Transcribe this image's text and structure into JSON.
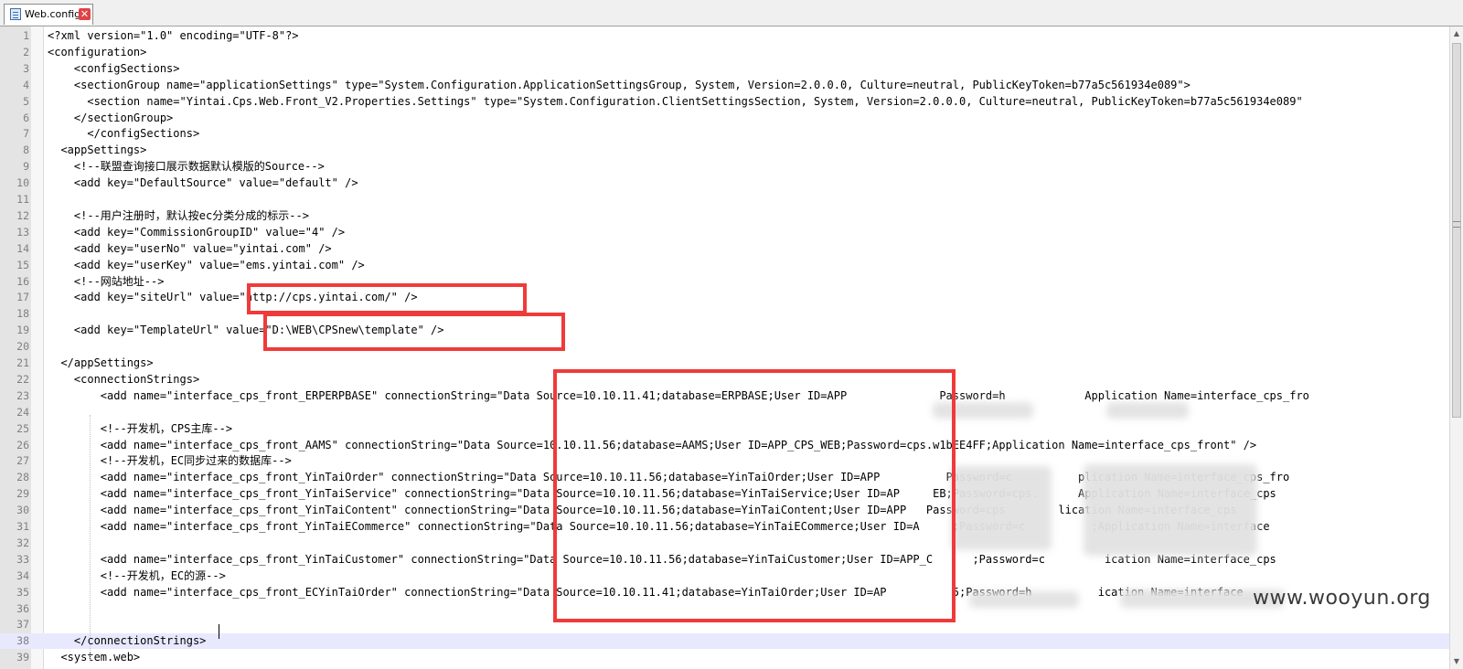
{
  "tab": {
    "label": "Web.config",
    "file_icon": "file-icon",
    "close_icon": "close-icon"
  },
  "editor": {
    "lines": [
      {
        "n": "1",
        "text": "<?xml version=\"1.0\" encoding=\"UTF-8\"?>"
      },
      {
        "n": "2",
        "text": "<configuration>"
      },
      {
        "n": "3",
        "text": "    <configSections>"
      },
      {
        "n": "4",
        "text": "    <sectionGroup name=\"applicationSettings\" type=\"System.Configuration.ApplicationSettingsGroup, System, Version=2.0.0.0, Culture=neutral, PublicKeyToken=b77a5c561934e089\">"
      },
      {
        "n": "5",
        "text": "      <section name=\"Yintai.Cps.Web.Front_V2.Properties.Settings\" type=\"System.Configuration.ClientSettingsSection, System, Version=2.0.0.0, Culture=neutral, PublicKeyToken=b77a5c561934e089\""
      },
      {
        "n": "6",
        "text": "    </sectionGroup>"
      },
      {
        "n": "7",
        "text": "      </configSections>"
      },
      {
        "n": "8",
        "text": "  <appSettings>"
      },
      {
        "n": "9",
        "text": "    <!--联盟查询接口展示数据默认模版的Source-->"
      },
      {
        "n": "10",
        "text": "    <add key=\"DefaultSource\" value=\"default\" />"
      },
      {
        "n": "11",
        "text": ""
      },
      {
        "n": "12",
        "text": "    <!--用户注册时，默认按ec分类分成的标示-->"
      },
      {
        "n": "13",
        "text": "    <add key=\"CommissionGroupID\" value=\"4\" />"
      },
      {
        "n": "14",
        "text": "    <add key=\"userNo\" value=\"yintai.com\" />"
      },
      {
        "n": "15",
        "text": "    <add key=\"userKey\" value=\"ems.yintai.com\" />"
      },
      {
        "n": "16",
        "text": "    <!--网站地址-->"
      },
      {
        "n": "17",
        "text": "    <add key=\"siteUrl\" value=\"http://cps.yintai.com/\" />"
      },
      {
        "n": "18",
        "text": ""
      },
      {
        "n": "19",
        "text": "    <add key=\"TemplateUrl\" value=\"D:\\WEB\\CPSnew\\template\" />"
      },
      {
        "n": "20",
        "text": ""
      },
      {
        "n": "21",
        "text": "  </appSettings>"
      },
      {
        "n": "22",
        "text": "    <connectionStrings>"
      },
      {
        "n": "23",
        "text": "        <add name=\"interface_cps_front_ERPERPBASE\" connectionString=\"Data Source=10.10.11.41;database=ERPBASE;User ID=APP              Password=h            Application Name=interface_cps_fro"
      },
      {
        "n": "24",
        "text": ""
      },
      {
        "n": "25",
        "text": "        <!--开发机，CPS主库-->"
      },
      {
        "n": "26",
        "text": "        <add name=\"interface_cps_front_AAMS\" connectionString=\"Data Source=10.10.11.56;database=AAMS;User ID=APP_CPS_WEB;Password=cps.w1bEE4FF;Application Name=interface_cps_front\" />"
      },
      {
        "n": "27",
        "text": "        <!--开发机，EC同步过来的数据库-->"
      },
      {
        "n": "28",
        "text": "        <add name=\"interface_cps_front_YinTaiOrder\" connectionString=\"Data Source=10.10.11.56;database=YinTaiOrder;User ID=APP          Password=c          plication Name=interface_cps_fro"
      },
      {
        "n": "29",
        "text": "        <add name=\"interface_cps_front_YinTaiService\" connectionString=\"Data Source=10.10.11.56;database=YinTaiService;User ID=AP     EB;Password=cps.      Application Name=interface_cps"
      },
      {
        "n": "30",
        "text": "        <add name=\"interface_cps_front_YinTaiContent\" connectionString=\"Data Source=10.10.11.56;database=YinTaiContent;User ID=APP   Password=cps        lication Name=interface_cps"
      },
      {
        "n": "31",
        "text": "        <add name=\"interface_cps_front_YinTaiECommerce\" connectionString=\"Data Source=10.10.11.56;database=YinTaiECommerce;User ID=A     ;Password=c          ;Application Name=interface"
      },
      {
        "n": "32",
        "text": ""
      },
      {
        "n": "33",
        "text": "        <add name=\"interface_cps_front_YinTaiCustomer\" connectionString=\"Data Source=10.10.11.56;database=YinTaiCustomer;User ID=APP_C      ;Password=c         ication Name=interface_cps"
      },
      {
        "n": "34",
        "text": "        <!--开发机，EC的源-->"
      },
      {
        "n": "35",
        "text": "        <add name=\"interface_cps_front_ECYinTaiOrder\" connectionString=\"Data Source=10.10.11.41;database=YinTaiOrder;User ID=AP          5;Password=h          ication Name=interface_"
      },
      {
        "n": "36",
        "text": ""
      },
      {
        "n": "37",
        "text": ""
      },
      {
        "n": "38",
        "text": "    </connectionStrings>"
      },
      {
        "n": "39",
        "text": "  <system.web>"
      }
    ]
  },
  "highlight_color": "#f03a3a",
  "watermark": "www.wooyun.org"
}
